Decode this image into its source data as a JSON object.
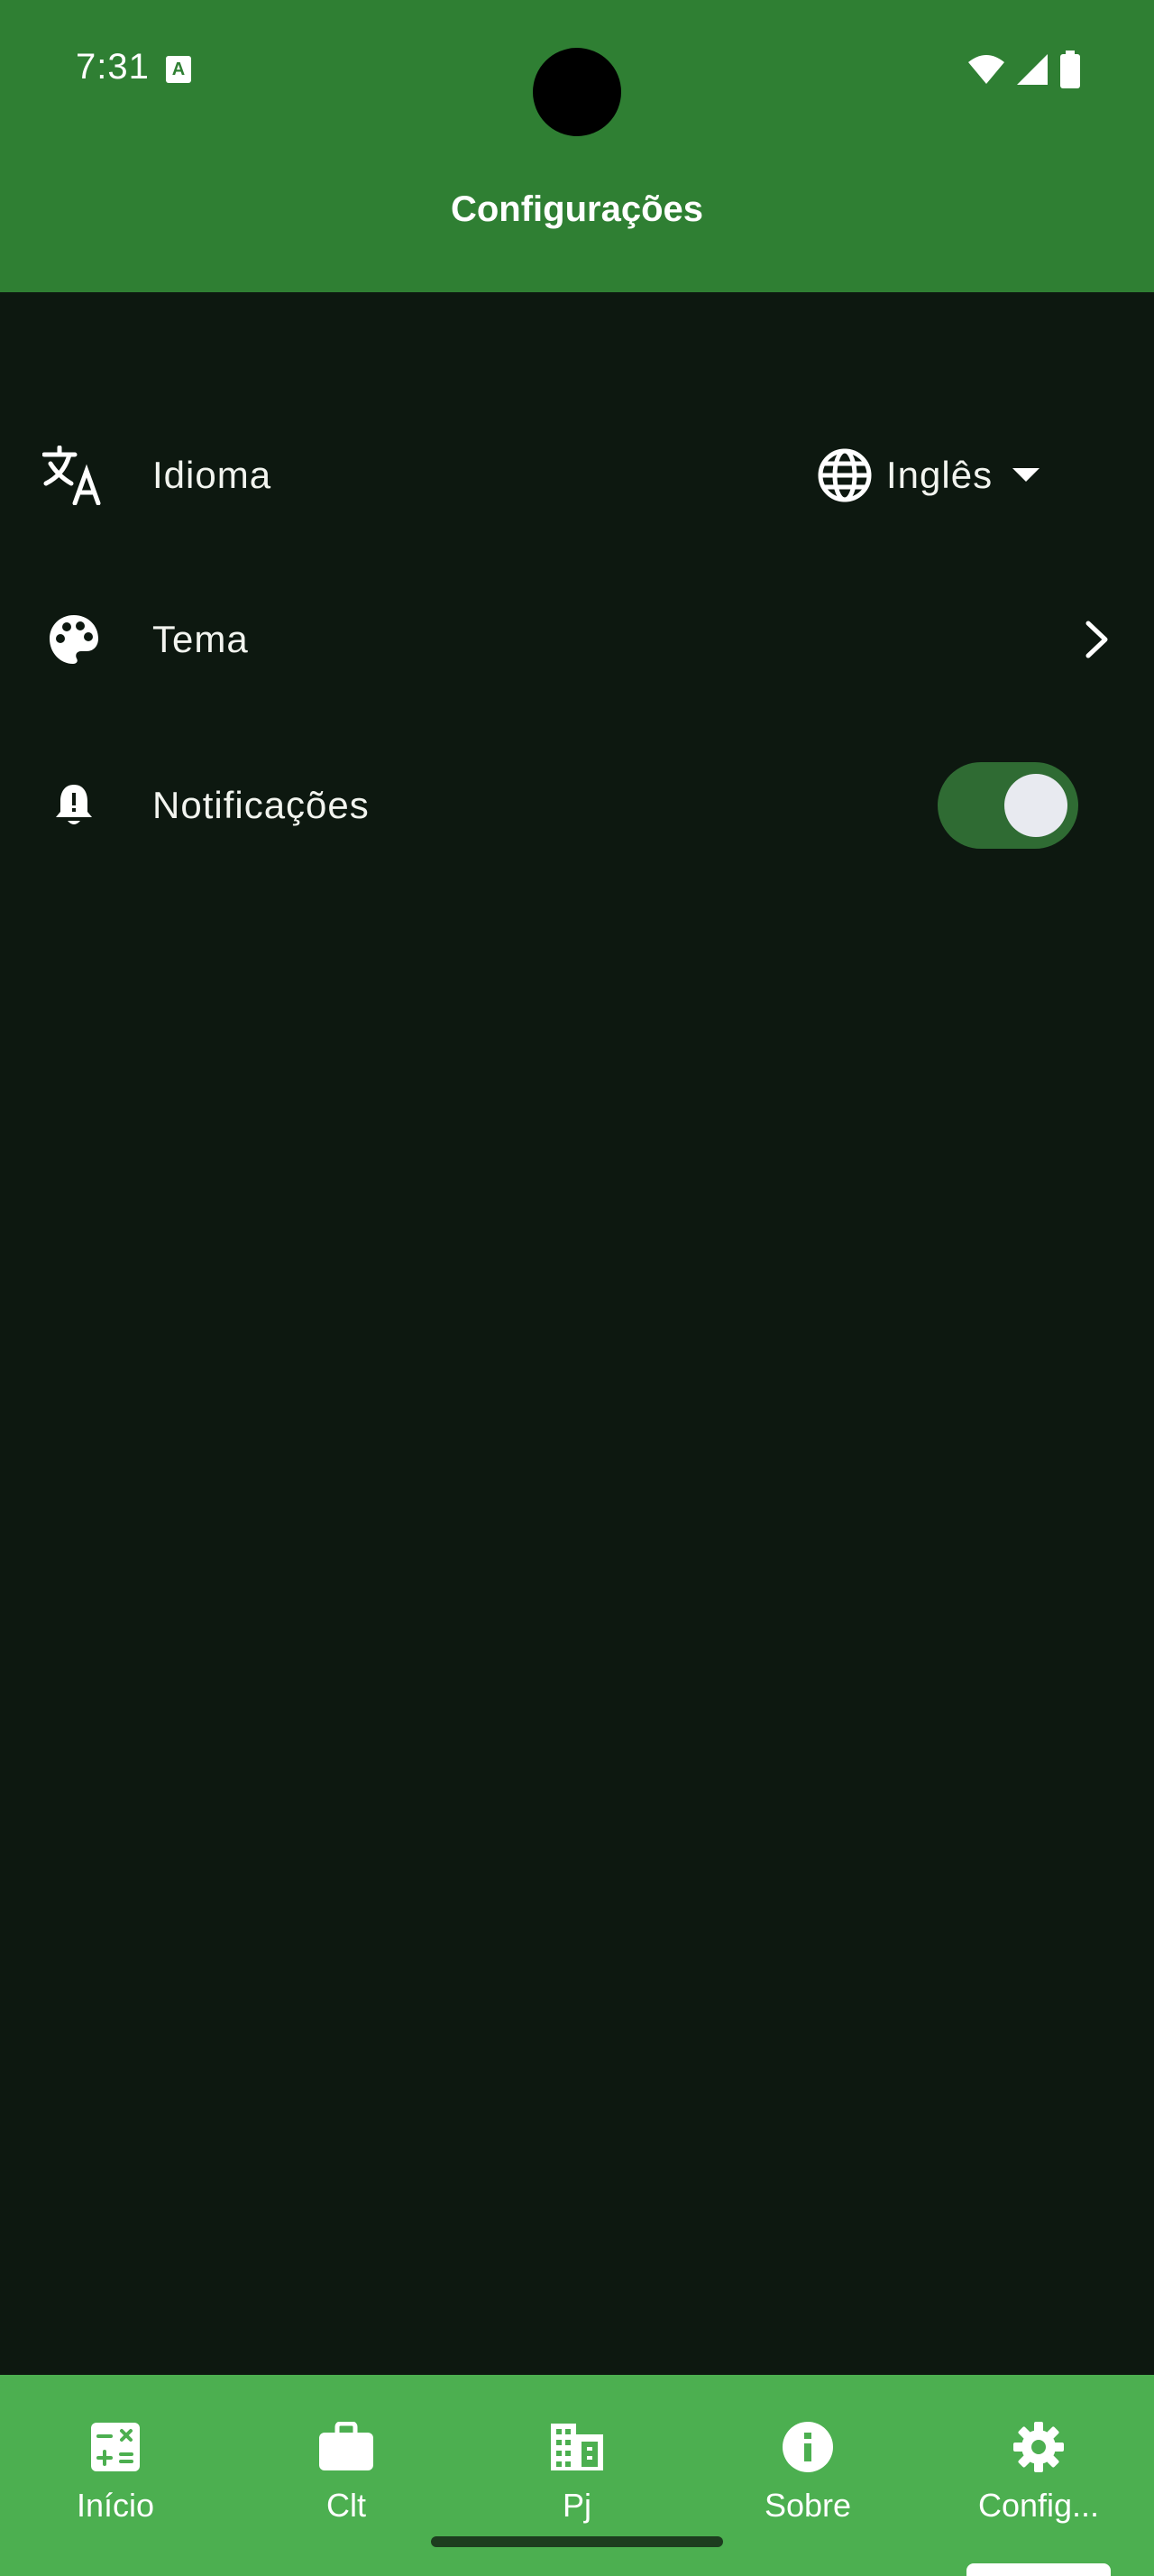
{
  "status_bar": {
    "time": "7:31"
  },
  "app_bar": {
    "title": "Configurações"
  },
  "settings": {
    "language": {
      "label": "Idioma",
      "icon": "translate-icon",
      "selected_value": "Inglês",
      "selector_icon": "globe-icon"
    },
    "theme": {
      "label": "Tema",
      "icon": "palette-icon"
    },
    "notifications": {
      "label": "Notificações",
      "icon": "bell-alert-icon",
      "enabled": true
    }
  },
  "bottom_nav": {
    "items": [
      {
        "label": "Início",
        "icon": "calculator-icon"
      },
      {
        "label": "Clt",
        "icon": "briefcase-icon"
      },
      {
        "label": "Pj",
        "icon": "building-icon"
      },
      {
        "label": "Sobre",
        "icon": "info-icon"
      },
      {
        "label": "Config...",
        "icon": "gear-icon"
      }
    ],
    "active_index": 4
  },
  "colors": {
    "app_bar": "#2f7f33",
    "background": "#0d1810",
    "bottom_nav": "#4caf50",
    "toggle_track": "#2f6b33",
    "toggle_knob": "#e8eaf0"
  }
}
